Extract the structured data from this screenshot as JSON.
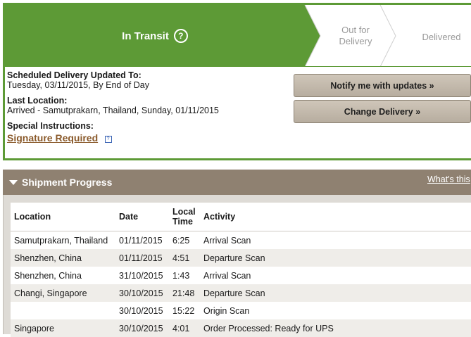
{
  "status": {
    "current_step": "In Transit",
    "help_glyph": "?",
    "steps": [
      {
        "line1": "Out for",
        "line2": "Delivery"
      },
      {
        "line1": "Delivered",
        "line2": ""
      }
    ],
    "accent_color": "#5d9a36"
  },
  "details": {
    "scheduled_label": "Scheduled Delivery Updated To:",
    "scheduled_value": "Tuesday, 03/11/2015, By End of Day",
    "last_location_label": "Last Location:",
    "last_location_value": "Arrived - Samutprakarn, Thailand, Sunday, 01/11/2015",
    "special_label": "Special Instructions:",
    "signature_link": "Signature Required",
    "help_icon_glyph": "?"
  },
  "actions": {
    "notify_label": "Notify me with updates »",
    "change_label": "Change Delivery »"
  },
  "shipment_progress": {
    "title": "Shipment Progress",
    "whats_this": "What's this",
    "columns": {
      "location": "Location",
      "date": "Date",
      "local_time_1": "Local",
      "local_time_2": "Time",
      "activity": "Activity"
    },
    "rows": [
      {
        "location": "Samutprakarn, Thailand",
        "date": "01/11/2015",
        "time": "6:25",
        "activity": "Arrival Scan"
      },
      {
        "location": "Shenzhen, China",
        "date": "01/11/2015",
        "time": "4:51",
        "activity": "Departure Scan"
      },
      {
        "location": "Shenzhen, China",
        "date": "31/10/2015",
        "time": "1:43",
        "activity": "Arrival Scan"
      },
      {
        "location": "Changi, Singapore",
        "date": "30/10/2015",
        "time": "21:48",
        "activity": "Departure Scan"
      },
      {
        "location": "",
        "date": "30/10/2015",
        "time": "15:22",
        "activity": "Origin Scan"
      },
      {
        "location": "Singapore",
        "date": "30/10/2015",
        "time": "4:01",
        "activity": "Order Processed: Ready for UPS"
      }
    ]
  }
}
